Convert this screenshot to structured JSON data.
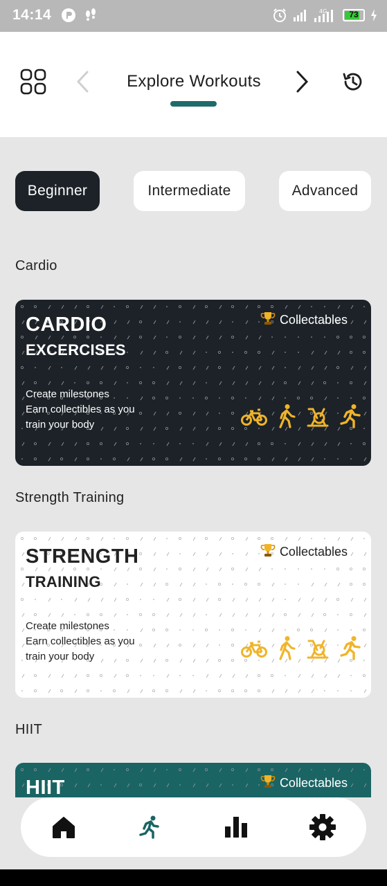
{
  "status_bar": {
    "time": "14:14",
    "battery_percent": "73",
    "network": "4G"
  },
  "header": {
    "title": "Explore Workouts",
    "menu_icon": "grid-icon",
    "prev_icon": "chevron-left-icon",
    "next_icon": "chevron-right-icon",
    "history_icon": "history-icon"
  },
  "levels": [
    {
      "label": "Beginner",
      "active": true
    },
    {
      "label": "Intermediate",
      "active": false
    },
    {
      "label": "Advanced",
      "active": false
    }
  ],
  "sections": [
    {
      "heading": "Cardio",
      "card": {
        "title": "CARDIO",
        "subtitle": "EXCERCISES",
        "badge": "Collectables",
        "desc_lines": [
          "Create milestones",
          "Earn collectibles as you",
          "train your body"
        ]
      }
    },
    {
      "heading": "Strength Training",
      "card": {
        "title": "STRENGTH",
        "subtitle": "TRAINING",
        "badge": "Collectables",
        "desc_lines": [
          "Create milestones",
          "Earn collectibles as you",
          "train your body"
        ]
      }
    },
    {
      "heading": "HIIT",
      "card": {
        "title": "HIIT",
        "badge": "Collectables"
      }
    }
  ],
  "bottom_nav": [
    {
      "name": "home",
      "icon": "home-icon"
    },
    {
      "name": "workouts",
      "icon": "runner-icon"
    },
    {
      "name": "stats",
      "icon": "bar-chart-icon"
    },
    {
      "name": "settings",
      "icon": "gear-icon"
    }
  ],
  "colors": {
    "dark": "#1c2228",
    "teal": "#1a6464",
    "accent_yellow": "#f0b429",
    "background": "#e6e6e6"
  }
}
